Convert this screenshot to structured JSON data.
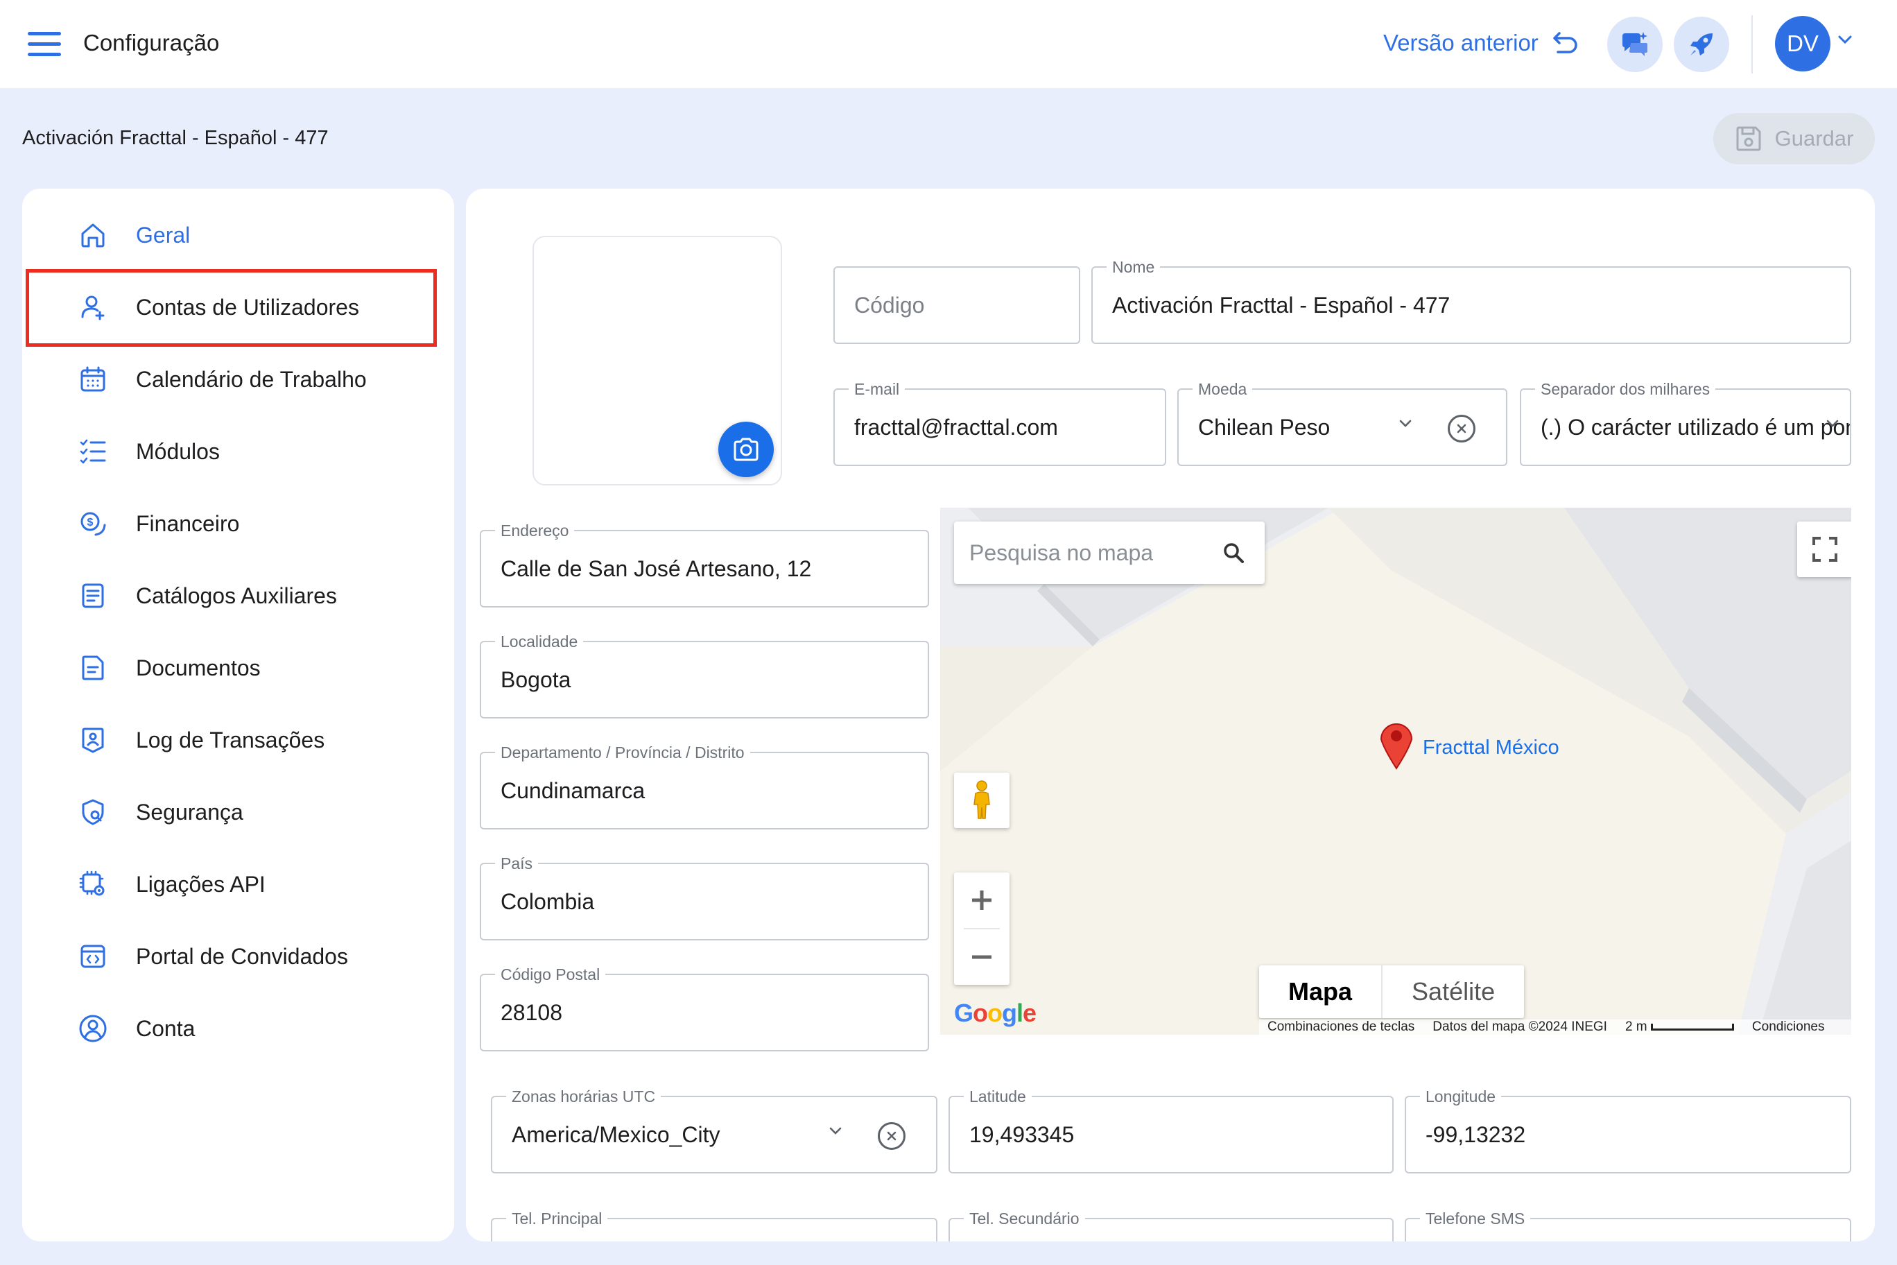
{
  "header": {
    "title": "Configuração",
    "prev_version_label": "Versão anterior",
    "avatar_initials": "DV"
  },
  "subheader": {
    "breadcrumb": "Activación Fracttal - Español - 477",
    "save_label": "Guardar"
  },
  "sidebar": {
    "items": [
      {
        "label": "Geral",
        "icon": "home-icon",
        "active": true
      },
      {
        "label": "Contas de Utilizadores",
        "icon": "user-add-icon",
        "active": false
      },
      {
        "label": "Calendário de Trabalho",
        "icon": "calendar-icon",
        "active": false
      },
      {
        "label": "Módulos",
        "icon": "checklist-icon",
        "active": false
      },
      {
        "label": "Financeiro",
        "icon": "money-icon",
        "active": false
      },
      {
        "label": "Catálogos Auxiliares",
        "icon": "catalog-icon",
        "active": false
      },
      {
        "label": "Documentos",
        "icon": "document-icon",
        "active": false
      },
      {
        "label": "Log de Transações",
        "icon": "log-icon",
        "active": false
      },
      {
        "label": "Segurança",
        "icon": "security-icon",
        "active": false
      },
      {
        "label": "Ligações API",
        "icon": "api-icon",
        "active": false
      },
      {
        "label": "Portal de Convidados",
        "icon": "portal-icon",
        "active": false
      },
      {
        "label": "Conta",
        "icon": "account-icon",
        "active": false
      }
    ]
  },
  "form": {
    "codigo": {
      "placeholder": "Código",
      "value": ""
    },
    "nome": {
      "label": "Nome",
      "value": "Activación Fracttal - Español - 477"
    },
    "email": {
      "label": "E-mail",
      "value": "fracttal@fracttal.com"
    },
    "moeda": {
      "label": "Moeda",
      "value": "Chilean Peso"
    },
    "separador": {
      "label": "Separador dos milhares",
      "value": "(.) O carácter utilizado é um ponto"
    },
    "endereco": {
      "label": "Endereço",
      "value": "Calle de San José Artesano, 12"
    },
    "localidade": {
      "label": "Localidade",
      "value": "Bogota"
    },
    "departamento": {
      "label": "Departamento / Província / Distrito",
      "value": "Cundinamarca"
    },
    "pais": {
      "label": "País",
      "value": "Colombia"
    },
    "codigo_postal": {
      "label": "Código Postal",
      "value": "28108"
    },
    "zonas": {
      "label": "Zonas horárias UTC",
      "value": "America/Mexico_City"
    },
    "latitude": {
      "label": "Latitude",
      "value": "19,493345"
    },
    "longitude": {
      "label": "Longitude",
      "value": "-99,13232"
    },
    "tel_principal": {
      "label": "Tel. Principal",
      "value": ""
    },
    "tel_secundario": {
      "label": "Tel. Secundário",
      "value": ""
    },
    "telefone_sms": {
      "label": "Telefone SMS",
      "value": ""
    }
  },
  "map": {
    "search_placeholder": "Pesquisa no mapa",
    "marker_label": "Fracttal México",
    "type_map": "Mapa",
    "type_satellite": "Satélite",
    "shortcuts": "Combinaciones de teclas",
    "data_credit": "Datos del mapa ©2024 INEGI",
    "scale": "2 m",
    "terms": "Condiciones"
  },
  "colors": {
    "accent": "#2f6fe4",
    "highlight": "#ee2b1f",
    "background": "#e8eefb"
  }
}
